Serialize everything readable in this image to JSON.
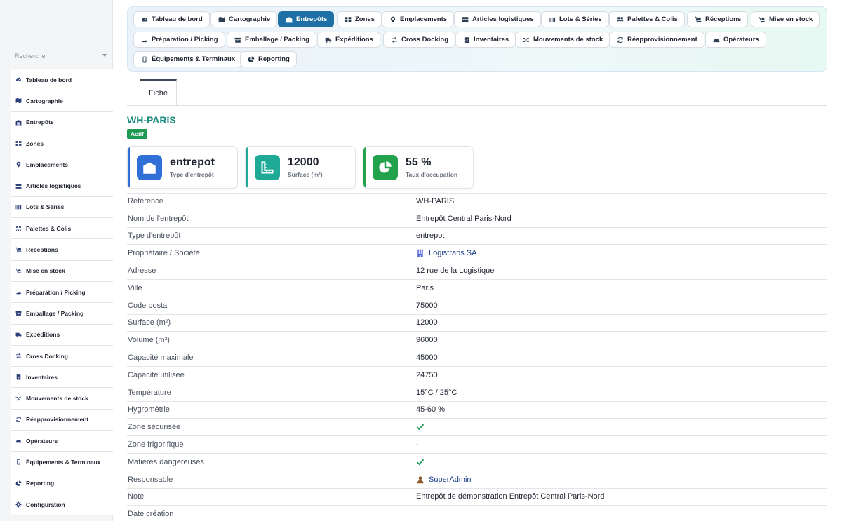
{
  "sidebar": {
    "search_placeholder": "Rechercher",
    "items": [
      {
        "label": "Tableau de bord",
        "icon": "gauge-icon"
      },
      {
        "label": "Cartographie",
        "icon": "map-icon"
      },
      {
        "label": "Entrepôts",
        "icon": "warehouse-icon"
      },
      {
        "label": "Zones",
        "icon": "grid-icon"
      },
      {
        "label": "Emplacements",
        "icon": "map-pin-icon"
      },
      {
        "label": "Articles logistiques",
        "icon": "boxes-icon"
      },
      {
        "label": "Lots & Séries",
        "icon": "barcode-icon"
      },
      {
        "label": "Palettes & Colis",
        "icon": "pallet-icon"
      },
      {
        "label": "Réceptions",
        "icon": "dolly-icon"
      },
      {
        "label": "Mise en stock",
        "icon": "hand-truck-icon"
      },
      {
        "label": "Préparation / Picking",
        "icon": "hand-holding-icon"
      },
      {
        "label": "Emballage / Packing",
        "icon": "package-icon"
      },
      {
        "label": "Expéditions",
        "icon": "truck-icon"
      },
      {
        "label": "Cross Docking",
        "icon": "exchange-icon"
      },
      {
        "label": "Inventaires",
        "icon": "clipboard-check-icon"
      },
      {
        "label": "Mouvements de stock",
        "icon": "shuffle-icon"
      },
      {
        "label": "Réapprovisionnement",
        "icon": "sync-icon"
      },
      {
        "label": "Opérateurs",
        "icon": "hard-hat-icon"
      },
      {
        "label": "Équipements & Terminaux",
        "icon": "mobile-icon"
      },
      {
        "label": "Reporting",
        "icon": "pie-chart-icon"
      },
      {
        "label": "Configuration",
        "icon": "gear-icon"
      }
    ]
  },
  "topnav": {
    "items": [
      {
        "label": "Tableau de bord",
        "icon": "gauge-icon"
      },
      {
        "label": "Cartographie",
        "icon": "map-icon"
      },
      {
        "label": "Entrepôts",
        "icon": "warehouse-icon",
        "active": true
      },
      {
        "label": "Zones",
        "icon": "grid-icon"
      },
      {
        "label": "Emplacements",
        "icon": "map-pin-icon"
      },
      {
        "label": "Articles logistiques",
        "icon": "boxes-icon"
      },
      {
        "label": "Lots & Séries",
        "icon": "barcode-icon"
      },
      {
        "label": "Palettes & Colis",
        "icon": "pallet-icon"
      },
      {
        "label": "Réceptions",
        "icon": "dolly-icon"
      },
      {
        "label": "Mise en stock",
        "icon": "hand-truck-icon"
      },
      {
        "label": "Préparation / Picking",
        "icon": "hand-holding-icon"
      },
      {
        "label": "Emballage / Packing",
        "icon": "package-icon"
      },
      {
        "label": "Expéditions",
        "icon": "truck-icon"
      },
      {
        "label": "Cross Docking",
        "icon": "exchange-icon"
      },
      {
        "label": "Inventaires",
        "icon": "clipboard-check-icon"
      },
      {
        "label": "Mouvements de stock",
        "icon": "shuffle-icon"
      },
      {
        "label": "Réapprovisionnement",
        "icon": "sync-icon"
      },
      {
        "label": "Opérateurs",
        "icon": "hard-hat-icon"
      },
      {
        "label": "Équipements & Terminaux",
        "icon": "mobile-icon"
      },
      {
        "label": "Reporting",
        "icon": "pie-chart-icon"
      }
    ]
  },
  "tabs": {
    "fiche": "Fiche"
  },
  "header": {
    "title": "WH-PARIS",
    "status": "Actif"
  },
  "cards": [
    {
      "value": "entrepot",
      "label": "Type d'entrepôt",
      "icon": "warehouse-icon",
      "color": "#2f6fd6"
    },
    {
      "value": "12000",
      "label": "Surface (m²)",
      "icon": "ruler-icon",
      "color": "#1faa98"
    },
    {
      "value": "55 %",
      "label": "Taux d'occupation",
      "icon": "pie-chart-icon",
      "color": "#22a24c"
    }
  ],
  "colors": {
    "accent": "#1e6fa6",
    "title": "#1a8a7e",
    "badge": "#1f9a55",
    "link": "#1d3f8a",
    "check": "#1f9a55"
  },
  "fields": [
    {
      "label": "Référence",
      "value": "WH-PARIS"
    },
    {
      "label": "Nom de l'entrepôt",
      "value": "Entrepôt Central Paris-Nord"
    },
    {
      "label": "Type d'entrepôt",
      "value": "entrepot"
    },
    {
      "label": "Propriétaire / Société",
      "value": "Logistrans SA",
      "type": "link",
      "icon": "building-icon"
    },
    {
      "label": "Adresse",
      "value": "12 rue de la Logistique"
    },
    {
      "label": "Ville",
      "value": "Paris"
    },
    {
      "label": "Code postal",
      "value": "75000"
    },
    {
      "label": "Surface (m²)",
      "value": "12000"
    },
    {
      "label": "Volume (m³)",
      "value": "96000"
    },
    {
      "label": "Capacité maximale",
      "value": "45000"
    },
    {
      "label": "Capacité utilisée",
      "value": "24750"
    },
    {
      "label": "Température",
      "value": "15°C / 25°C"
    },
    {
      "label": "Hygrométrie",
      "value": "45-60 %"
    },
    {
      "label": "Zone sécurisée",
      "type": "check",
      "checked": true
    },
    {
      "label": "Zone frigorifique",
      "value": "-",
      "type": "dash"
    },
    {
      "label": "Matières dangereuses",
      "type": "check",
      "checked": true
    },
    {
      "label": "Responsable",
      "value": "SuperAdmin",
      "type": "link",
      "icon": "user-icon"
    },
    {
      "label": "Note",
      "value": "Entrepôt de démonstration Entrepôt Central Paris-Nord"
    },
    {
      "label": "Date création",
      "value": ""
    }
  ]
}
